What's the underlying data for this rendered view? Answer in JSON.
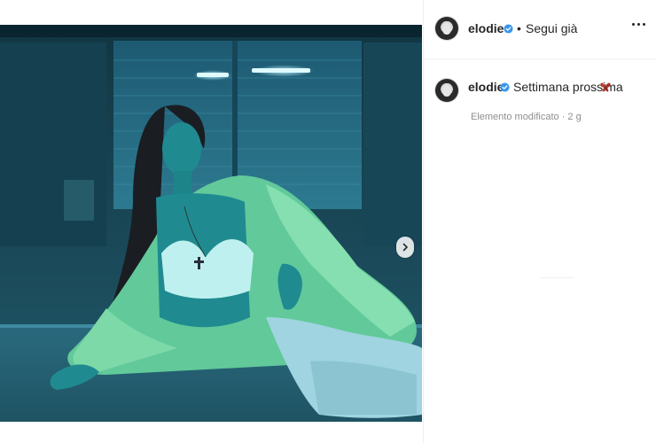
{
  "post": {
    "image": {
      "alt": "",
      "carousel": {
        "count": 3,
        "active": 0
      }
    },
    "nav": {
      "next_icon": "chevron-right-icon"
    }
  },
  "header": {
    "username": "elodie",
    "verified_icon": "verified-badge-icon",
    "separator": "•",
    "follow_label": "Segui già",
    "more_icon": "more-options-icon"
  },
  "caption": {
    "username": "elodie",
    "verified_icon": "verified-badge-icon",
    "text": "Settimana prossima",
    "emoji": "butterfly-emoji",
    "meta": "Elemento modificato · 2 g"
  },
  "colors": {
    "verified": "#3897f0",
    "meta_text": "#8e8e8e",
    "emoji": "#c0392b"
  }
}
